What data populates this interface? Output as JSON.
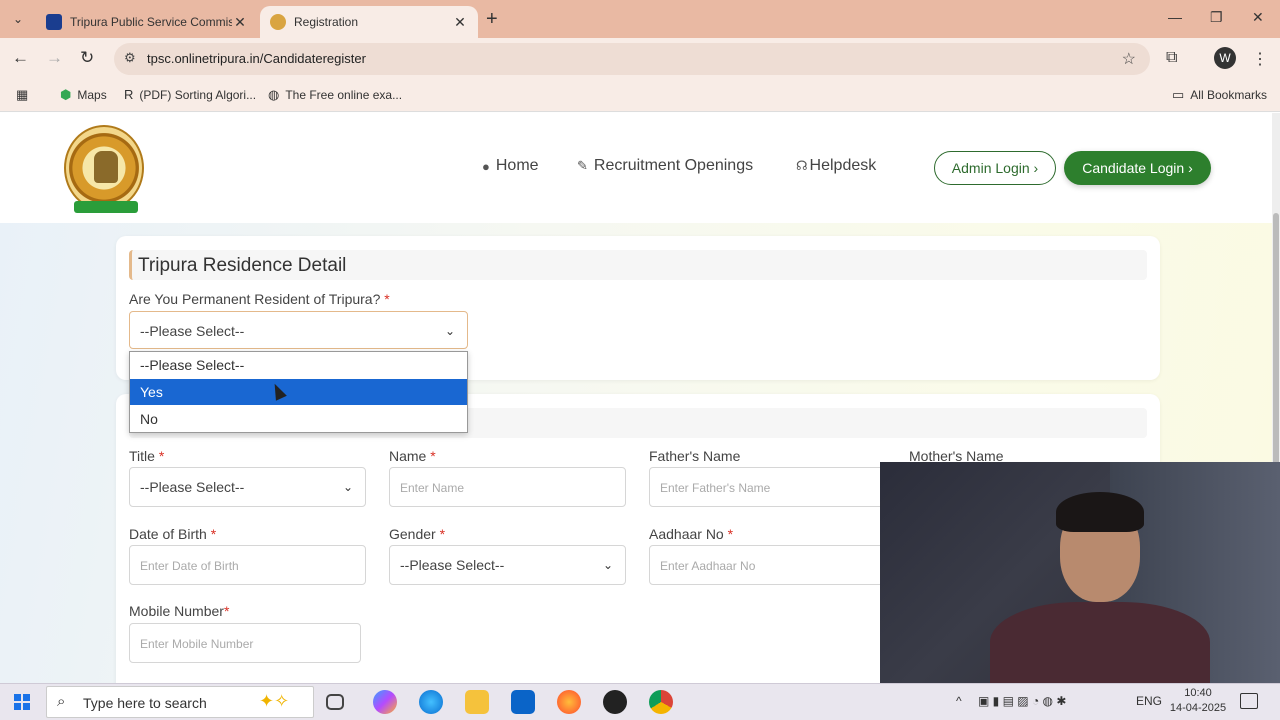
{
  "browser": {
    "tabs": [
      {
        "title": "Tripura Public Service Commiss",
        "active": false
      },
      {
        "title": "Registration",
        "active": true
      }
    ],
    "url": "tpsc.onlinetripura.in/Candidateregister",
    "bookmarks": [
      {
        "label": "Maps",
        "icon": "maps-icon"
      },
      {
        "label": "(PDF) Sorting Algori...",
        "icon": "researchgate-icon"
      },
      {
        "label": "The Free online exa...",
        "icon": "globe-icon"
      }
    ],
    "all_bookmarks": "All Bookmarks"
  },
  "header": {
    "nav": [
      {
        "label": "Home",
        "icon": "home-icon"
      },
      {
        "label": "Recruitment Openings",
        "icon": "edit-icon"
      },
      {
        "label": "Helpdesk",
        "icon": "helpdesk-icon"
      }
    ],
    "admin_login": "Admin Login",
    "candidate_login": "Candidate Login"
  },
  "residence": {
    "section_title": "Tripura Residence Detail",
    "question": "Are You Permanent Resident of Tripura?",
    "required_mark": "*",
    "selected": "--Please Select--",
    "options": [
      "--Please Select--",
      "Yes",
      "No"
    ],
    "highlighted_option": "Yes"
  },
  "personal": {
    "fields": {
      "title_label": "Title",
      "title_value": "--Please Select--",
      "name_label": "Name",
      "name_placeholder": "Enter Name",
      "father_label": "Father's Name",
      "father_placeholder": "Enter Father's Name",
      "mother_label": "Mother's Name",
      "dob_label": "Date of Birth",
      "dob_placeholder": "Enter Date of Birth",
      "gender_label": "Gender",
      "gender_value": "--Please Select--",
      "aadhaar_label": "Aadhaar No",
      "aadhaar_placeholder": "Enter Aadhaar No",
      "mobile_label": "Mobile Number",
      "mobile_placeholder": "Enter Mobile Number"
    }
  },
  "taskbar": {
    "search_placeholder": "Type here to search",
    "language": "ENG",
    "time": "10:40",
    "date": "14-04-2025"
  }
}
